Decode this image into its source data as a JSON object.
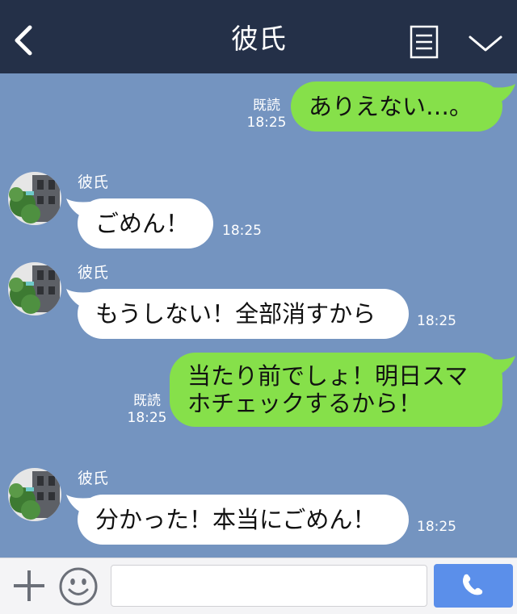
{
  "header": {
    "title": "彼氏",
    "back_icon": "chevron-left-icon",
    "menu_icon": "menu-icon",
    "collapse_icon": "chevron-down-icon"
  },
  "messages": [
    {
      "direction": "out",
      "text": "ありえない…。",
      "read_label": "既読",
      "time": "18:25"
    },
    {
      "direction": "in",
      "sender": "彼氏",
      "text": "ごめん！",
      "time": "18:25"
    },
    {
      "direction": "in",
      "sender": "彼氏",
      "text": "もうしない！全部消すから",
      "time": "18:25"
    },
    {
      "direction": "out",
      "text": "当たり前でしょ！明日スマ\nホチェックするから！",
      "read_label": "既読",
      "time": "18:25"
    },
    {
      "direction": "in",
      "sender": "彼氏",
      "text": "分かった！本当にごめん！",
      "time": "18:25"
    }
  ],
  "input_bar": {
    "plus_icon": "plus-icon",
    "emoji_icon": "emoji-icon",
    "message_value": "",
    "call_icon": "phone-icon"
  },
  "colors": {
    "header_bg": "#243048",
    "chat_bg": "#7494c0",
    "incoming_bubble": "#ffffff",
    "outgoing_bubble": "#86e04a",
    "call_button": "#5b8fea"
  }
}
